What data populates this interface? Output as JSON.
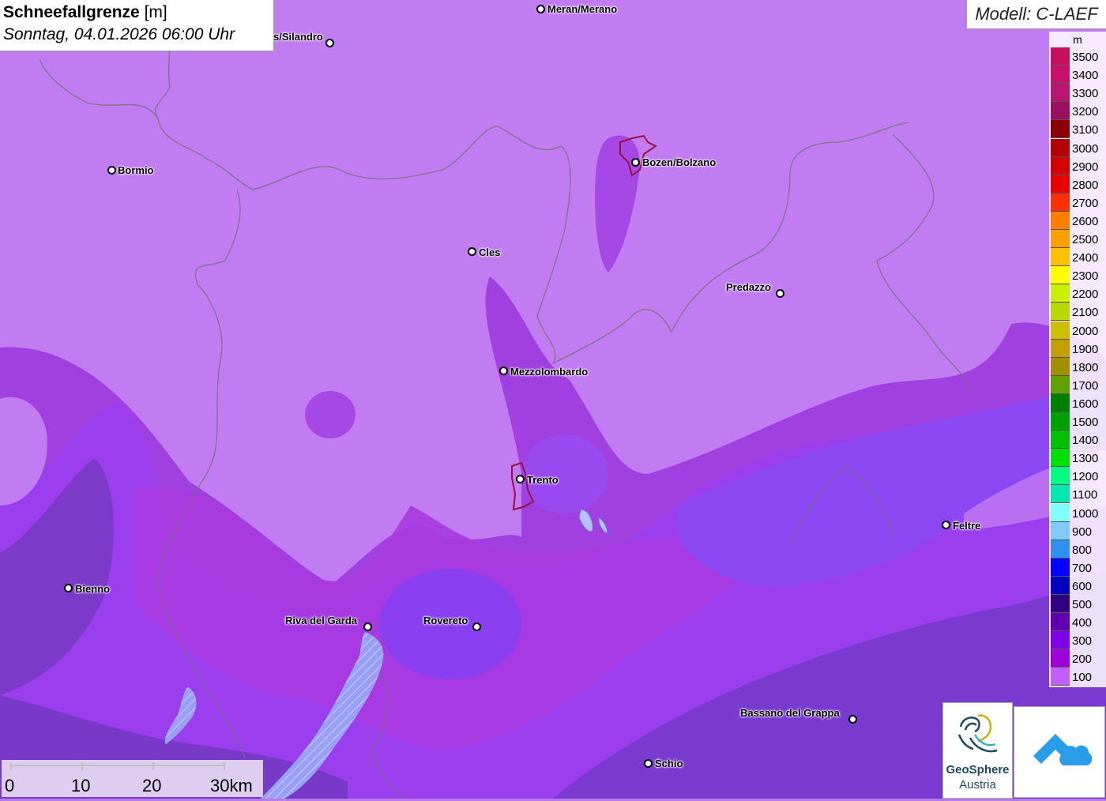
{
  "title": {
    "main": "Schneefallgrenze",
    "unit": "[m]",
    "datetime": "Sonntag, 04.01.2026 06:00 Uhr"
  },
  "model": "Modell: C-LAEF",
  "legend": {
    "unit": "m",
    "levels": [
      {
        "value": "3500",
        "color": "#c8105a"
      },
      {
        "value": "3400",
        "color": "#c8106a"
      },
      {
        "value": "3300",
        "color": "#b81470"
      },
      {
        "value": "3200",
        "color": "#9a1060"
      },
      {
        "value": "3100",
        "color": "#8a0000"
      },
      {
        "value": "3000",
        "color": "#b00000"
      },
      {
        "value": "2900",
        "color": "#d40000"
      },
      {
        "value": "2800",
        "color": "#e80000"
      },
      {
        "value": "2700",
        "color": "#ff3000"
      },
      {
        "value": "2600",
        "color": "#ff8000"
      },
      {
        "value": "2500",
        "color": "#ffa000"
      },
      {
        "value": "2400",
        "color": "#ffc000"
      },
      {
        "value": "2300",
        "color": "#ffff00"
      },
      {
        "value": "2200",
        "color": "#c8f000"
      },
      {
        "value": "2100",
        "color": "#b8d800"
      },
      {
        "value": "2000",
        "color": "#c8c000"
      },
      {
        "value": "1900",
        "color": "#c0a000"
      },
      {
        "value": "1800",
        "color": "#a09000"
      },
      {
        "value": "1700",
        "color": "#60a000"
      },
      {
        "value": "1600",
        "color": "#008000"
      },
      {
        "value": "1500",
        "color": "#00a000"
      },
      {
        "value": "1400",
        "color": "#00c000"
      },
      {
        "value": "1300",
        "color": "#00e000"
      },
      {
        "value": "1200",
        "color": "#00ff80"
      },
      {
        "value": "1100",
        "color": "#00e8b0"
      },
      {
        "value": "1000",
        "color": "#80ffff"
      },
      {
        "value": "900",
        "color": "#80c8ff"
      },
      {
        "value": "800",
        "color": "#3090f0"
      },
      {
        "value": "700",
        "color": "#0000ff"
      },
      {
        "value": "600",
        "color": "#0000c0"
      },
      {
        "value": "500",
        "color": "#300080"
      },
      {
        "value": "400",
        "color": "#6000b0"
      },
      {
        "value": "300",
        "color": "#8000e8"
      },
      {
        "value": "200",
        "color": "#a000d8"
      },
      {
        "value": "100",
        "color": "#c060f8"
      }
    ]
  },
  "cities": [
    {
      "name": "Meran/Merano"
    },
    {
      "name": "s/Silandro"
    },
    {
      "name": "Bormio"
    },
    {
      "name": "Bozen/Bolzano"
    },
    {
      "name": "Cles"
    },
    {
      "name": "Predazzo"
    },
    {
      "name": "Mezzolombardo"
    },
    {
      "name": "Trento"
    },
    {
      "name": "Feltre"
    },
    {
      "name": "Bienno"
    },
    {
      "name": "Riva del Garda"
    },
    {
      "name": "Rovereto"
    },
    {
      "name": "Bassano del Grappa"
    },
    {
      "name": "Schio"
    }
  ],
  "scale": {
    "labels": [
      "0",
      "10",
      "20",
      "30km"
    ]
  },
  "logos": {
    "geosphere_line1": "GeoSphere",
    "geosphere_line2": "Austria"
  }
}
